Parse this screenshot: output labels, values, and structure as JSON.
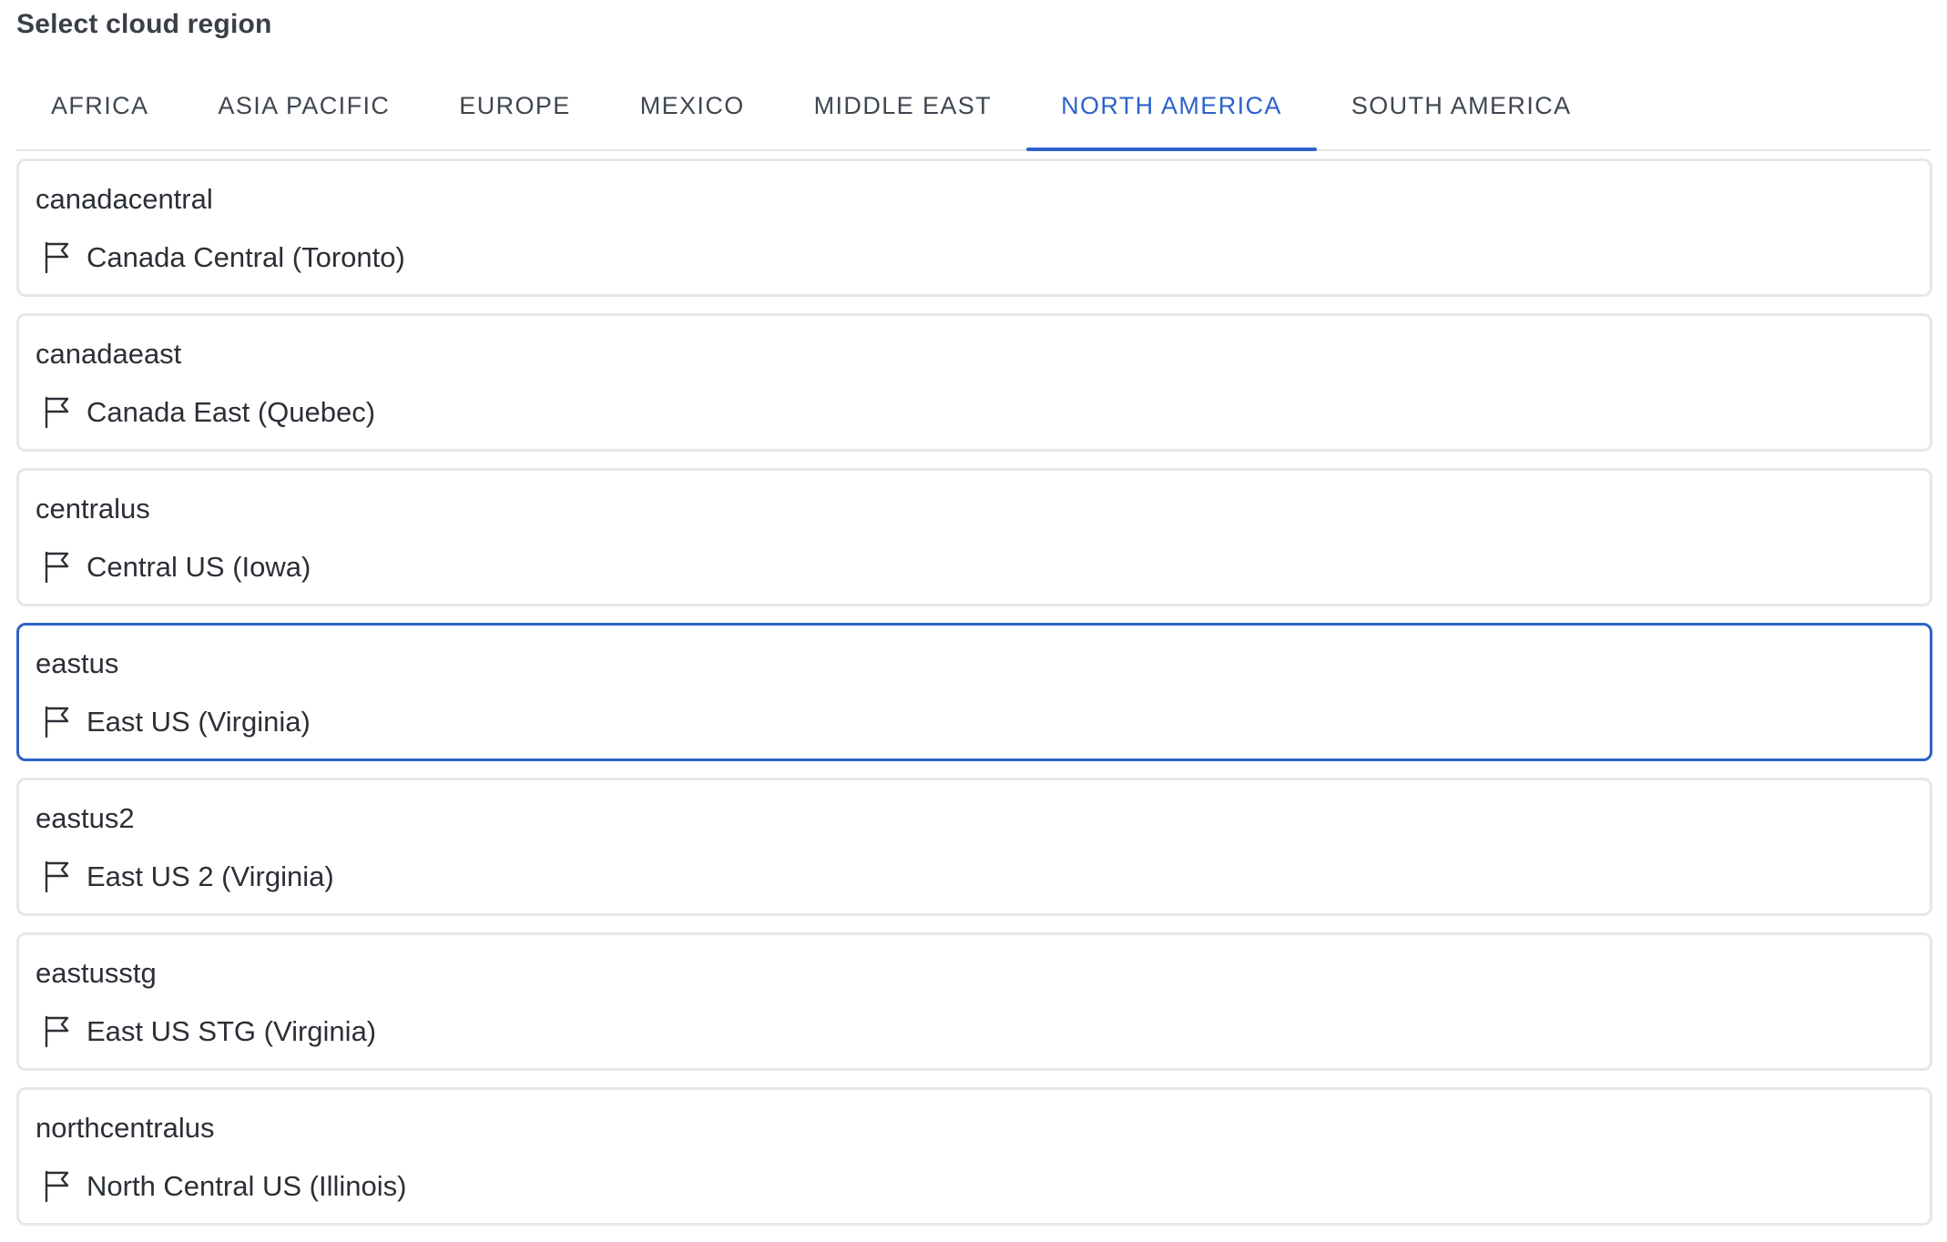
{
  "header": {
    "title": "Select cloud region"
  },
  "tabs": [
    {
      "label": "AFRICA",
      "active": false
    },
    {
      "label": "ASIA PACIFIC",
      "active": false
    },
    {
      "label": "EUROPE",
      "active": false
    },
    {
      "label": "MEXICO",
      "active": false
    },
    {
      "label": "MIDDLE EAST",
      "active": false
    },
    {
      "label": "NORTH AMERICA",
      "active": true
    },
    {
      "label": "SOUTH AMERICA",
      "active": false
    }
  ],
  "regions": [
    {
      "code": "canadacentral",
      "name": "Canada Central (Toronto)",
      "icon": "flag-icon",
      "selected": false
    },
    {
      "code": "canadaeast",
      "name": "Canada East (Quebec)",
      "icon": "flag-icon",
      "selected": false
    },
    {
      "code": "centralus",
      "name": "Central US (Iowa)",
      "icon": "flag-icon",
      "selected": false
    },
    {
      "code": "eastus",
      "name": "East US (Virginia)",
      "icon": "flag-icon",
      "selected": true
    },
    {
      "code": "eastus2",
      "name": "East US 2 (Virginia)",
      "icon": "flag-icon",
      "selected": false
    },
    {
      "code": "eastusstg",
      "name": "East US STG (Virginia)",
      "icon": "flag-icon",
      "selected": false
    },
    {
      "code": "northcentralus",
      "name": "North Central US (Illinois)",
      "icon": "flag-icon",
      "selected": false
    }
  ],
  "colors": {
    "accent": "#2e62c8",
    "text": "#2b2f36",
    "tab_text": "#3f4650",
    "card_border": "#e6e7ea"
  }
}
